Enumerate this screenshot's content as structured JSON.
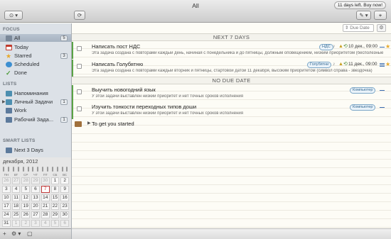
{
  "window": {
    "title": "All",
    "trial_text": "11 days left. Buy now!"
  },
  "toolbar": {
    "left_btn_glyph": "⊙ ▾",
    "refresh_glyph": "⟳",
    "right_btn1_glyph": "✎ ▾",
    "right_btn2_glyph": "⌖"
  },
  "sidebar": {
    "focus_header": "FOCUS",
    "focus_items": [
      {
        "label": "All",
        "count": "5",
        "icon": "all-icon",
        "color": "#7a8899"
      },
      {
        "label": "Today",
        "count": "",
        "icon": "today-icon",
        "color": "#c0392b"
      },
      {
        "label": "Starred",
        "count": "3",
        "icon": "star-icon",
        "color": "#e7a92a"
      },
      {
        "label": "Scheduled",
        "count": "",
        "icon": "scheduled-icon",
        "color": "#3d8fd1"
      },
      {
        "label": "Done",
        "count": "",
        "icon": "done-icon",
        "color": "#4f9c3c"
      }
    ],
    "lists_header": "LISTS",
    "lists_items": [
      {
        "label": "Напоминания",
        "count": "",
        "color": "#4d8fb0"
      },
      {
        "label": "Личный Задачи",
        "count": "1",
        "color": "#4d8fb0"
      },
      {
        "label": "Work",
        "count": "",
        "color": "#5c7a9c"
      },
      {
        "label": "Рабочий Зада...",
        "count": "1",
        "color": "#5c7a9c"
      }
    ],
    "smart_header": "SMART LISTS",
    "smart_items": [
      {
        "label": "Next 3 Days",
        "color": "#5c7a9c"
      }
    ],
    "calendar": {
      "month": "декабря, 2012",
      "weekdays": [
        "ПН",
        "ВТ",
        "СР",
        "ЧТ",
        "ПТ",
        "СБ",
        "ВС"
      ],
      "days": [
        "26",
        "27",
        "28",
        "29",
        "30",
        "1",
        "2",
        "3",
        "4",
        "5",
        "6",
        "7",
        "8",
        "9",
        "10",
        "11",
        "12",
        "13",
        "14",
        "15",
        "16",
        "17",
        "18",
        "19",
        "20",
        "21",
        "22",
        "23",
        "24",
        "25",
        "26",
        "27",
        "28",
        "29",
        "30",
        "31",
        "1",
        "2",
        "3",
        "4",
        "5",
        "6"
      ],
      "today": "7"
    },
    "bottom_glyphs": [
      "+",
      "⚙ ▾",
      "▢"
    ]
  },
  "main": {
    "sort_label": "Due Date",
    "groups": [
      {
        "header": "NEXT 7 DAYS",
        "tasks": [
          {
            "title": "Написать пост НДС",
            "desc": "Эта задача создана с повторами каждый день, начиная с понедельника и до пятницы, должным оповещением, низким приоритетом (бесполезные",
            "tag": "НДС",
            "due": "10 дек., 09:00"
          },
          {
            "title": "Написать Голубятню",
            "desc": "Эта задача создана с повторами каждый вторник и пятницы, стартовой датой 11 декабря, высоким приоритетом (символ справа - звездочка)",
            "tag": "Голубятни",
            "due": "11 дек., 09:00"
          }
        ]
      },
      {
        "header": "NO DUE DATE",
        "tasks": [
          {
            "title": "Выучить новогодний язык",
            "desc": "У этой задачи выставлен низкий приоритет и нет точных сроков исполнения",
            "tag": "Компьютер"
          },
          {
            "title": "Изучить тонкости переходных типов доши",
            "desc": "У этой задачи выставлен низкий приоритет и нет точных сроков исполнения",
            "tag": "Компьютер"
          }
        ]
      }
    ],
    "started": {
      "label": "To get you started"
    }
  },
  "colors": {
    "accent_green": "#5aa346",
    "tag_blue": "#356a93",
    "star": "#e7a92a",
    "today_red": "#c23b3b"
  }
}
